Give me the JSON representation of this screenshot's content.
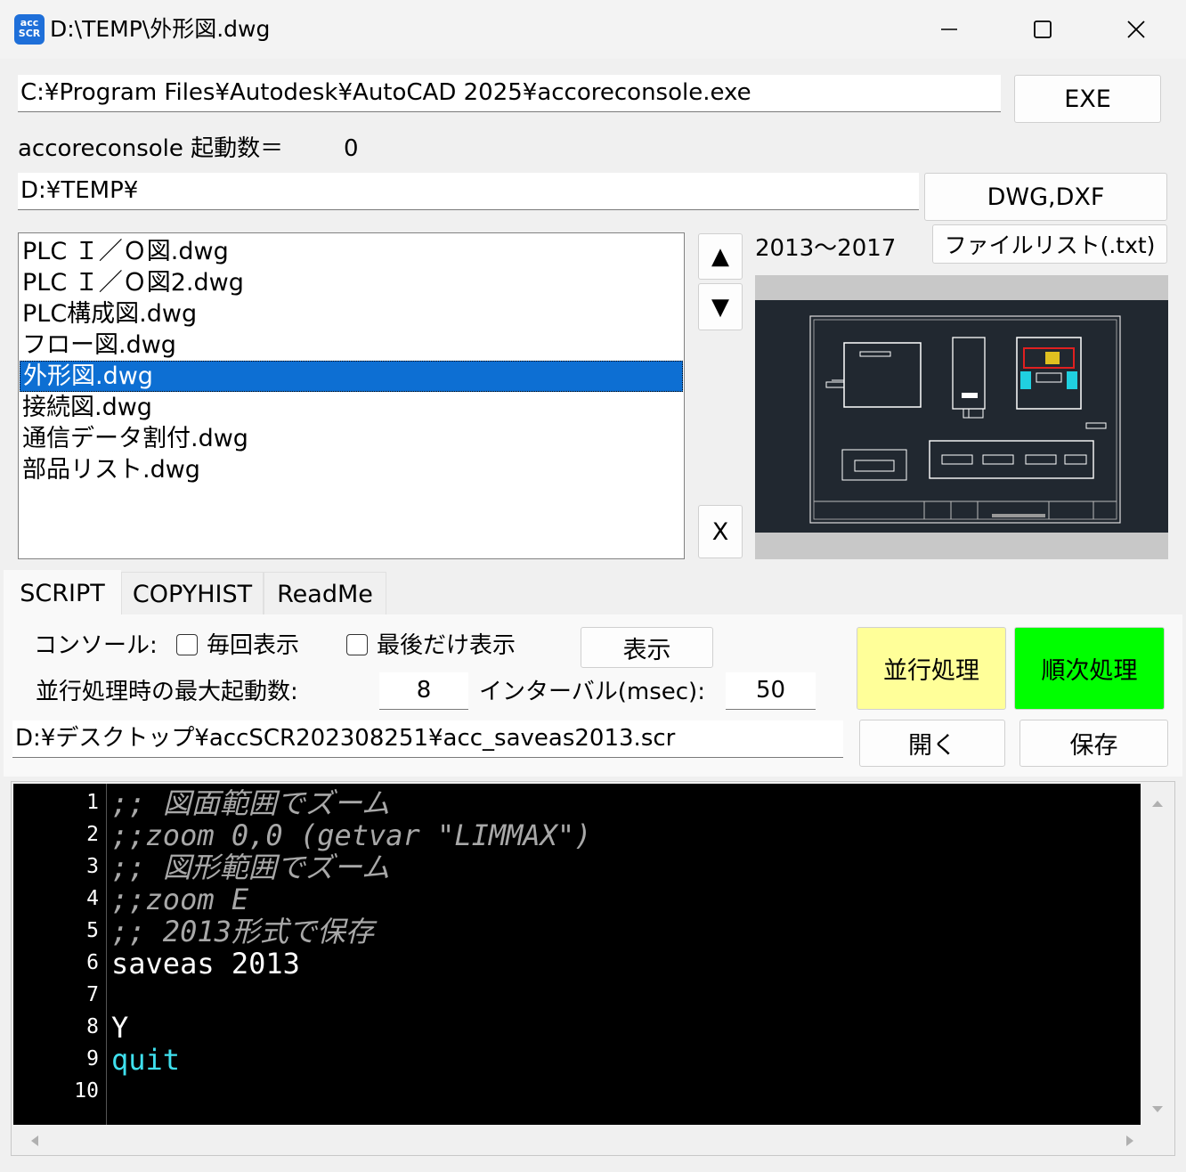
{
  "window": {
    "title": "D:\\TEMP\\外形図.dwg",
    "icon_text_top": "acc",
    "icon_text_bottom": "SCR"
  },
  "exe": {
    "path": "C:¥Program Files¥Autodesk¥AutoCAD 2025¥accoreconsole.exe",
    "button": "EXE"
  },
  "console_count": {
    "label": "accoreconsole 起動数＝",
    "value": "0"
  },
  "folder": {
    "path": "D:¥TEMP¥",
    "button": "DWG,DXF"
  },
  "files": [
    "PLC Ｉ／Ｏ図.dwg",
    "PLC Ｉ／Ｏ図2.dwg",
    "PLC構成図.dwg",
    "フロー図.dwg",
    "外形図.dwg",
    "接続図.dwg",
    "通信データ割付.dwg",
    "部品リスト.dwg"
  ],
  "selected_file_index": 4,
  "list_buttons": {
    "up": "▲",
    "down": "▼",
    "remove": "X"
  },
  "version_label": "2013～2017",
  "filelist_button": "ファイルリスト(.txt)",
  "tabs": [
    "SCRIPT",
    "COPYHIST",
    "ReadMe"
  ],
  "active_tab": "SCRIPT",
  "script_panel": {
    "console_label": "コンソール:",
    "every_time_label": "毎回表示",
    "last_only_label": "最後だけ表示",
    "show_button": "表示",
    "max_label": "並行処理時の最大起動数:",
    "max_value": "8",
    "interval_label": "インターバル(msec):",
    "interval_value": "50",
    "parallel_button": "並行処理",
    "sequential_button": "順次処理",
    "script_path": "D:¥デスクトップ¥accSCR202308251¥acc_saveas2013.scr",
    "open_button": "開く",
    "save_button": "保存"
  },
  "colors": {
    "parallel_bg": "#ffff99",
    "sequential_bg": "#00ff00",
    "selection": "#0d6fd3",
    "editor_bg": "#000000",
    "comment": "#a8a8a8",
    "keyword": "#3fe0ee"
  },
  "editor_lines": [
    {
      "num": "1",
      "text": ";; 図面範囲でズーム",
      "style": "comment"
    },
    {
      "num": "2",
      "text": ";;zoom 0,0 (getvar \"LIMMAX\")",
      "style": "comment"
    },
    {
      "num": "3",
      "text": ";; 図形範囲でズーム",
      "style": "comment"
    },
    {
      "num": "4",
      "text": ";;zoom E",
      "style": "comment"
    },
    {
      "num": "5",
      "text": ";; 2013形式で保存",
      "style": "comment"
    },
    {
      "num": "6",
      "text": "saveas 2013",
      "style": "plain"
    },
    {
      "num": "7",
      "text": "",
      "style": "plain"
    },
    {
      "num": "8",
      "text": "Y",
      "style": "plain"
    },
    {
      "num": "9",
      "text": "quit",
      "style": "kw"
    },
    {
      "num": "10",
      "text": "",
      "style": "plain"
    }
  ]
}
